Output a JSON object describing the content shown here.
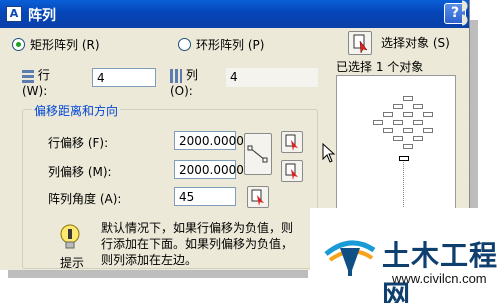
{
  "window": {
    "title": "阵列",
    "help_label": "?"
  },
  "array_type": {
    "rect_label": "矩形阵列 (R)",
    "polar_label": "环形阵列 (P)",
    "selected": "rect"
  },
  "select_objects": {
    "label": "选择对象 (S)",
    "count_text": "已选择 1 个对象"
  },
  "rows": {
    "label": "行 (W):",
    "value": "4"
  },
  "columns": {
    "label": "列 (O):",
    "value": "4"
  },
  "offset_group": {
    "title": "偏移距离和方向",
    "row_offset_label": "行偏移 (F):",
    "row_offset_value": "2000.0000",
    "col_offset_label": "列偏移 (M):",
    "col_offset_value": "2000.0000",
    "angle_label": "阵列角度 (A):",
    "angle_value": "45"
  },
  "hint": {
    "label": "提示",
    "text": "默认情况下，如果行偏移为负值，则行添加在下面。如果列偏移为负值，则列添加在左边。"
  },
  "watermark": {
    "title": "土木工程网",
    "url": "www.civilcn.com"
  },
  "colors": {
    "title_bar": "#0a4fc8",
    "dialog_bg": "#ece9d8",
    "group_title": "#0046d5",
    "watermark_title": "#0f3f6e"
  }
}
